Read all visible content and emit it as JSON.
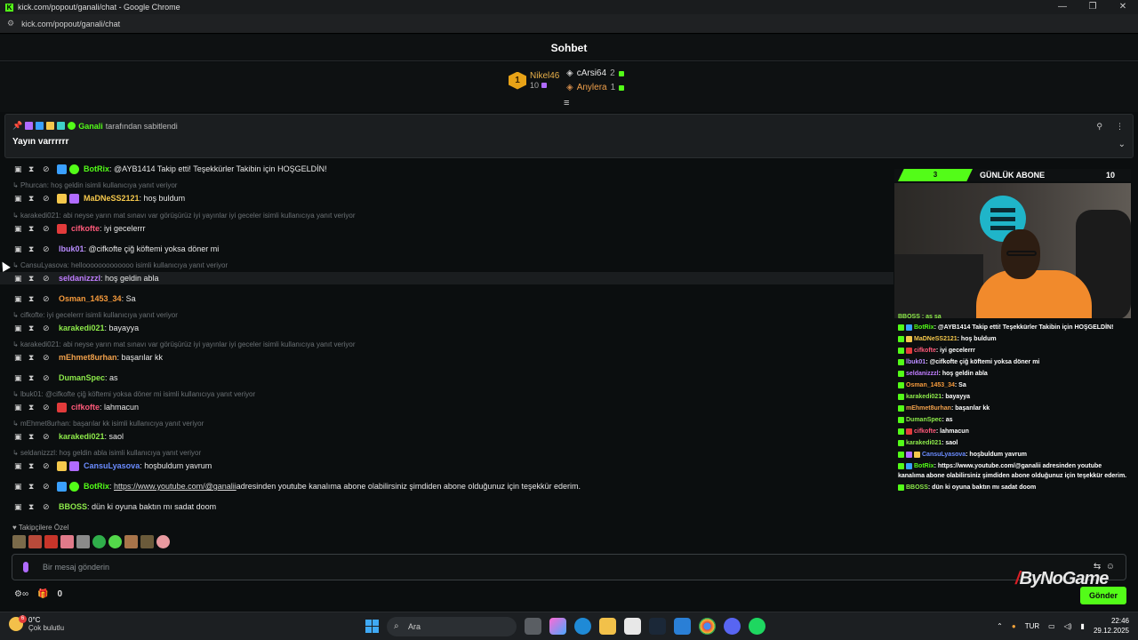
{
  "browser": {
    "window_title": "kick.com/popout/ganali/chat - Google Chrome",
    "url": "kick.com/popout/ganali/chat",
    "controls": [
      "—",
      "❐",
      "✕"
    ]
  },
  "chat_header": {
    "title": "Sohbet"
  },
  "leaderboard": {
    "first": {
      "rank": "1",
      "name": "Nikel46",
      "count": "10"
    },
    "second": {
      "name": "cArsi64",
      "count": "2"
    },
    "third": {
      "name": "Anylera",
      "count": "1"
    }
  },
  "pinned": {
    "author": "Ganali",
    "suffix": "tarafından sabitlendi",
    "text": "Yayın varrrrrr"
  },
  "replies": [
    "Phurcan: hoş geldin isimli kullanıcıya yanıt veriyor",
    "karakedi021: abi neyse yarın mat sınavı var görüşürüz iyi yayınlar iyi geceler isimli kullanıcıya yanıt veriyor",
    "CansuLyasova: hellooooooooooooo isimli kullanıcıya yanıt veriyor",
    "cifkofte: iyi gecelerrr isimli kullanıcıya yanıt veriyor",
    "karakedi021: abi neyse yarın mat sınavı var görüşürüz iyi yayınlar iyi geceler isimli kullanıcıya yanıt veriyor",
    "lbuk01: @cifkofte çiğ köftemi yoksa döner mi isimli kullanıcıya yanıt veriyor",
    "mEhmet8urhan: başarılar kk isimli kullanıcıya yanıt veriyor",
    "seldanizzzl: hoş geldin abla isimli kullanıcıya yanıt veriyor"
  ],
  "messages": [
    {
      "user": "BotRix",
      "text": ": @AYB1414 Takip etti! Teşekkürler Takibin için HOŞGELDİN!",
      "color": "#53fc18"
    },
    {
      "user": "MaDNeSS2121",
      "text": ": hoş buldum",
      "color": "#f5c84c"
    },
    {
      "user": "cifkofte",
      "text": ": iyi gecelerrr",
      "color": "#ff5a7a"
    },
    {
      "user": "lbuk01",
      "text": ": @cifkofte çiğ köftemi yoksa döner mi",
      "color": "#b98cff"
    },
    {
      "user": "seldanizzzl",
      "text": ": hoş geldin abla",
      "color": "#c07dff"
    },
    {
      "user": "Osman_1453_34",
      "text": ": Sa",
      "color": "#f59a3c"
    },
    {
      "user": "karakedi021",
      "text": ": bayayya",
      "color": "#8dea4a"
    },
    {
      "user": "mEhmet8urhan",
      "text": ": başarılar kk",
      "color": "#f0a04b"
    },
    {
      "user": "DumanSpec",
      "text": ": as",
      "color": "#8dea4a"
    },
    {
      "user": "cifkofte",
      "text": ": lahmacun",
      "color": "#ff5a7a"
    },
    {
      "user": "karakedi021",
      "text": ": saol",
      "color": "#8dea4a"
    },
    {
      "user": "CansuLyasova",
      "text": ": hoşbuldum yavrum",
      "color": "#6b8cff"
    },
    {
      "user": "BotRix",
      "text": ":",
      "link": "https://www.youtube.com/@ganalii",
      "tail": " adresinden youtube kanalıma abone olabilirsiniz şimdiden abone olduğunuz için teşekkür ederim.",
      "color": "#53fc18"
    },
    {
      "user": "BBOSS",
      "text": ": dün ki oyuna baktın mı sadat doom",
      "color": "#8dea4a"
    }
  ],
  "followers_only": "Takipçilere Özel",
  "input": {
    "placeholder": "Bir mesaj gönderin"
  },
  "bottom": {
    "count": "0"
  },
  "send_label": "Gönder",
  "overlay": {
    "sub_progress": "3",
    "sub_label": "GÜNLÜK ABONE",
    "sub_goal": "10",
    "truncated_top": "BBOSS : as sa",
    "brand": "ByNoGame",
    "lines": [
      {
        "user": "BotRix",
        "text": " : @AYB1414 Takip etti! Teşekkürler Takibin için HOŞGELDİN!",
        "color": "#53fc18"
      },
      {
        "user": "MaDNeSS2121",
        "text": " : hoş buldum",
        "color": "#f5c84c"
      },
      {
        "user": "cifkofte",
        "text": " : iyi gecelerrr",
        "color": "#ff5a7a"
      },
      {
        "user": "lbuk01",
        "text": " : @cifkofte çiğ köftemi yoksa döner mi",
        "color": "#b98cff"
      },
      {
        "user": "seldanizzzl",
        "text": " : hoş geldin abla",
        "color": "#c07dff"
      },
      {
        "user": "Osman_1453_34",
        "text": " : Sa",
        "color": "#f59a3c"
      },
      {
        "user": "karakedi021",
        "text": " : bayayya",
        "color": "#8dea4a"
      },
      {
        "user": "mEhmet8urhan",
        "text": " : başarılar kk",
        "color": "#f0a04b"
      },
      {
        "user": "DumanSpec",
        "text": " : as",
        "color": "#8dea4a"
      },
      {
        "user": "cifkofte",
        "text": " : lahmacun",
        "color": "#ff5a7a"
      },
      {
        "user": "karakedi021",
        "text": " : saol",
        "color": "#8dea4a"
      },
      {
        "user": "CansuLyasova",
        "text": " : hoşbuldum yavrum",
        "color": "#6b8cff"
      },
      {
        "user": "BotRix",
        "text": " : https://www.youtube.com/@ganalii adresinden youtube",
        "color": "#53fc18"
      },
      {
        "user": "",
        "text": "kanalıma abone olabilirsiniz şimdiden abone olduğunuz için teşekkür ederim.",
        "color": "#ffffff"
      },
      {
        "user": "BBOSS",
        "text": " : dün ki oyuna baktın mı sadat doom",
        "color": "#8dea4a"
      }
    ]
  },
  "taskbar": {
    "temp": "0°C",
    "weather": "Çok bulutlu",
    "weather_badge": "6",
    "search": "Ara",
    "lang": "TUR",
    "time": "22:46",
    "date": "29.12.2025"
  }
}
